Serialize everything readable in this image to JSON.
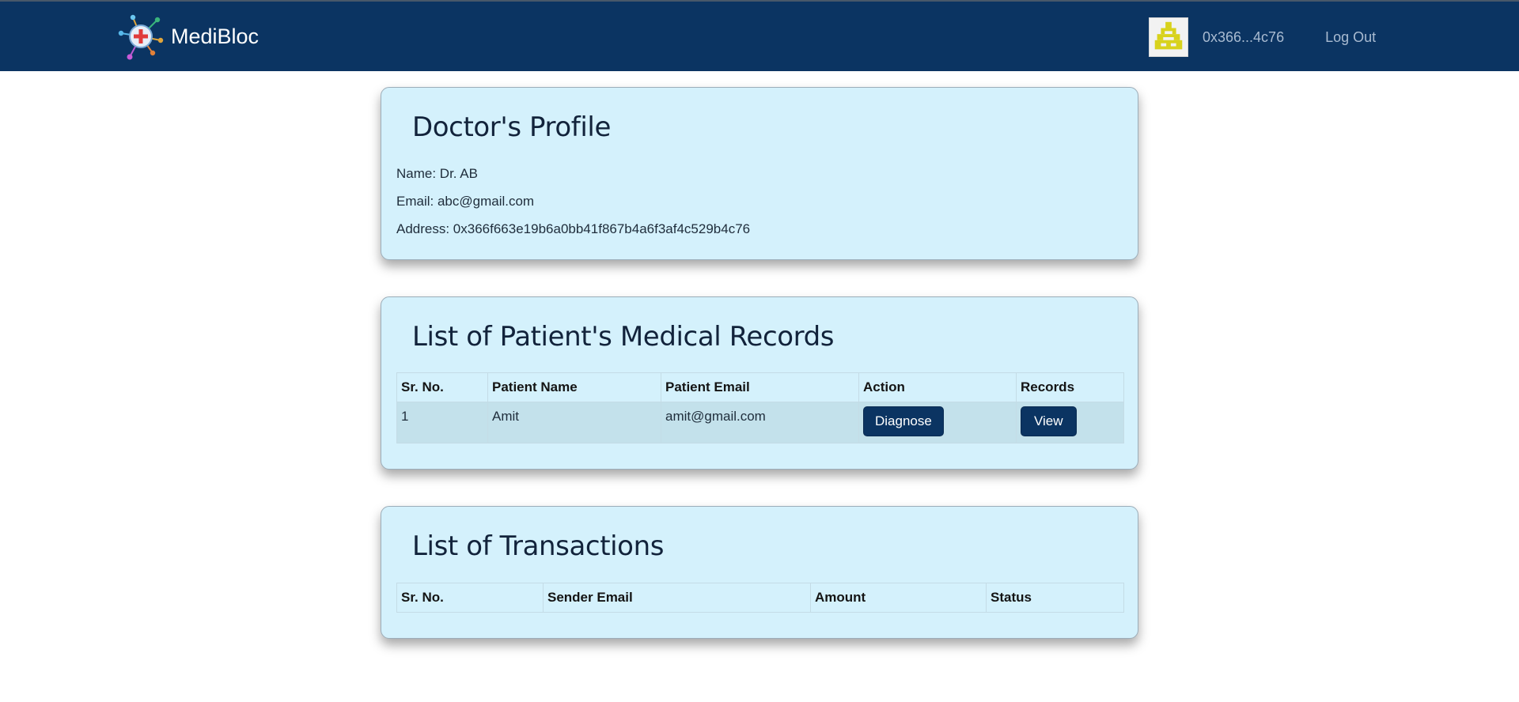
{
  "navbar": {
    "brand_name": "MediBloc",
    "account_address": "0x366...4c76",
    "logout_label": "Log Out"
  },
  "profile": {
    "title": "Doctor's Profile",
    "name": "Name: Dr. AB",
    "email": "Email: abc@gmail.com",
    "address": "Address: 0x366f663e19b6a0bb41f867b4a6f3af4c529b4c76"
  },
  "records": {
    "title": "List of Patient's Medical Records",
    "columns": [
      "Sr. No.",
      "Patient Name",
      "Patient Email",
      "Action",
      "Records"
    ],
    "rows": [
      {
        "sr_no": "1",
        "patient_name": "Amit",
        "patient_email": "amit@gmail.com",
        "action_label": "Diagnose",
        "records_label": "View"
      }
    ]
  },
  "transactions": {
    "title": "List of Transactions",
    "columns": [
      "Sr. No.",
      "Sender Email",
      "Amount",
      "Status"
    ],
    "rows": []
  },
  "colors": {
    "navbar": "#0b3462",
    "card_background": "#d4f1fc",
    "table_row_highlight": "#c3e1eb",
    "button": "#0b3462",
    "avatar_glyph": "#d8d21c"
  },
  "icons": {
    "brand_logo": "medical-network-logo-icon",
    "avatar": "pixel-identicon-avatar"
  }
}
